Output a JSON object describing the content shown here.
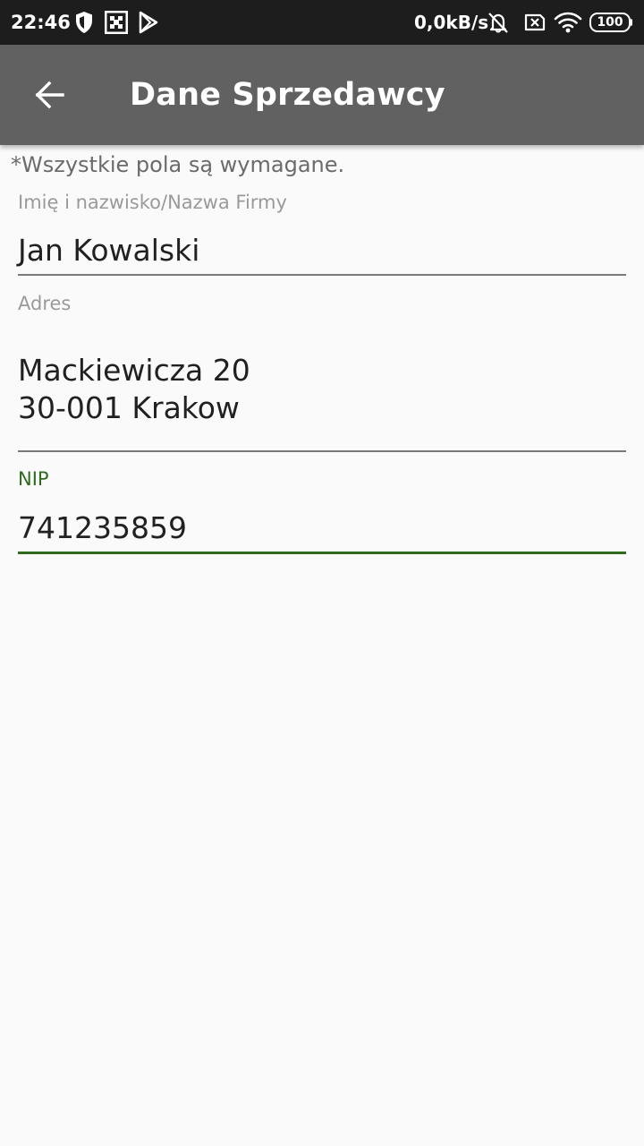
{
  "status_bar": {
    "time": "22:46",
    "net_speed": "0,0kB/s",
    "battery_level": "100",
    "icons": [
      "shield-icon",
      "grid-icon",
      "play-store-icon",
      "bell-muted-icon",
      "sim-x-icon",
      "wifi-icon",
      "battery-icon"
    ]
  },
  "app_bar": {
    "back_icon": "arrow-left-icon",
    "title": "Dane Sprzedawcy",
    "background": "#616161"
  },
  "form": {
    "required_note": "*Wszystkie pola są wymagane.",
    "fields": [
      {
        "label": "Imię i nazwisko/Nazwa Firmy",
        "value": "Jan Kowalski",
        "focused": false
      },
      {
        "label": "Adres",
        "value": "Mackiewicza 20\n30-001 Krakow",
        "focused": false
      },
      {
        "label": "NIP",
        "value": "741235859",
        "focused": true
      }
    ],
    "accent_color": "#2e6b1f"
  }
}
